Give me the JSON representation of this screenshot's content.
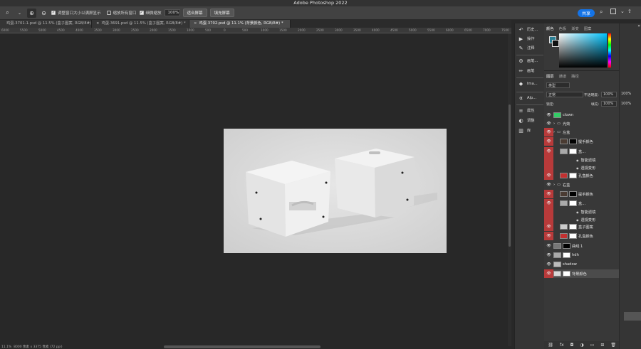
{
  "app": {
    "title": "Adobe Photoshop 2022"
  },
  "options_bar": {
    "checkbox1": "调整窗口大小以满屏显示",
    "checkbox2": "缩放所有窗口",
    "checkbox3": "细微缩放",
    "zoom_value": "100%",
    "fit_screen": "适合屏幕",
    "fill_screen": "填充屏幕",
    "share": "共享"
  },
  "tabs": [
    {
      "name": "鸡蛋.3701-1.psd @ 11.5% (盒子图案, RGB/8#)",
      "close": ""
    },
    {
      "name": "鸡蛋.3691.psd @ 11.5% (盒子图案, RGB/8#) *",
      "close": "×"
    },
    {
      "name": "鸡蛋.3702.psd @ 11.1% (背景颜色, RGB/8#) *",
      "close": "×"
    }
  ],
  "ruler_ticks": [
    "6000",
    "5500",
    "5000",
    "4500",
    "4000",
    "3500",
    "3000",
    "2500",
    "2000",
    "1500",
    "1000",
    "500",
    "0",
    "500",
    "1000",
    "1500",
    "2000",
    "2500",
    "3000",
    "3500",
    "4000",
    "4500",
    "5000",
    "5500",
    "6000",
    "6500",
    "7000",
    "7500"
  ],
  "status": {
    "zoom": "11.1%",
    "size": "8000 像素 x 3375 像素 (72 ppi)"
  },
  "dock_items": [
    {
      "label": "历史...",
      "icon": "history-icon"
    },
    {
      "label": "操作",
      "icon": "actions-icon"
    },
    {
      "label": "注释",
      "icon": "notes-icon"
    },
    {
      "label": "画笔...",
      "icon": "brush-settings-icon"
    },
    {
      "label": "画笔",
      "icon": "brush-icon"
    },
    {
      "label": "Ima...",
      "icon": "cube-icon"
    },
    {
      "label": "Alp...",
      "icon": "alpha-icon"
    },
    {
      "label": "属性",
      "icon": "properties-icon"
    },
    {
      "label": "调整",
      "icon": "adjustments-icon"
    },
    {
      "label": "库",
      "icon": "libraries-icon"
    }
  ],
  "color_panel": {
    "tabs": [
      "颜色",
      "色板",
      "渐变",
      "图案"
    ]
  },
  "layers_panel": {
    "tabs": [
      "图层",
      "通道",
      "路径"
    ],
    "filter": "类型",
    "blend_mode": "正常",
    "opacity_label": "不透明度:",
    "opacity": "100%",
    "lock_label": "锁定:",
    "fill_label": "填充:",
    "fill": "100%",
    "layers": [
      "clown",
      "光效",
      "左盒",
      "提手颜色",
      "盒...",
      "智能滤镜",
      "透视变形",
      "孔盒颜色",
      "右盒",
      "提手颜色",
      "盒...",
      "智能滤镜",
      "透视变形",
      "盒子图案",
      "孔盒颜色",
      "曲线 1",
      "hdh",
      "shadow",
      "背景颜色"
    ]
  },
  "far_right": {
    "values": [
      "100%",
      "100%"
    ]
  }
}
